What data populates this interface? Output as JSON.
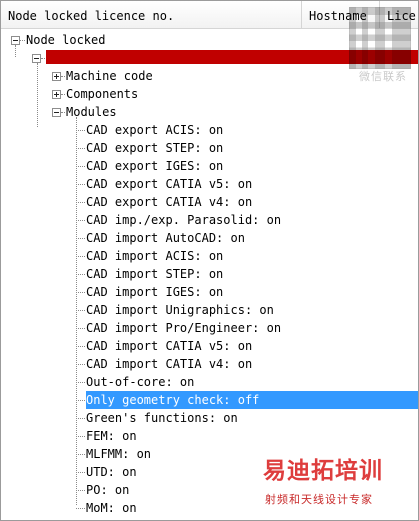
{
  "columns": [
    "Node locked licence no.",
    "Hostname",
    "Lice"
  ],
  "tree": {
    "root": "Node locked",
    "group_items": [
      "Machine code",
      "Components",
      "Modules"
    ],
    "modules": [
      "CAD export ACIS: on",
      "CAD export STEP: on",
      "CAD export IGES: on",
      "CAD export CATIA v5: on",
      "CAD export CATIA v4: on",
      "CAD imp./exp. Parasolid: on",
      "CAD import AutoCAD: on",
      "CAD import ACIS: on",
      "CAD import STEP: on",
      "CAD import IGES: on",
      "CAD import Unigraphics: on",
      "CAD import Pro/Engineer: on",
      "CAD import CATIA v5: on",
      "CAD import CATIA v4: on",
      "Out-of-core: on",
      "Only geometry check: off",
      "Green's functions: on",
      "FEM: on",
      "MLFMM: on",
      "UTD: on",
      "PO: on",
      "MoM: on"
    ]
  },
  "watermark": {
    "wechat": "微信联系",
    "brand": "易迪拓培训",
    "subtitle": "射频和天线设计专家"
  },
  "colors": {
    "selection": "#3399ff",
    "redacted": "#c00000",
    "brand": "#dc2d2d"
  }
}
